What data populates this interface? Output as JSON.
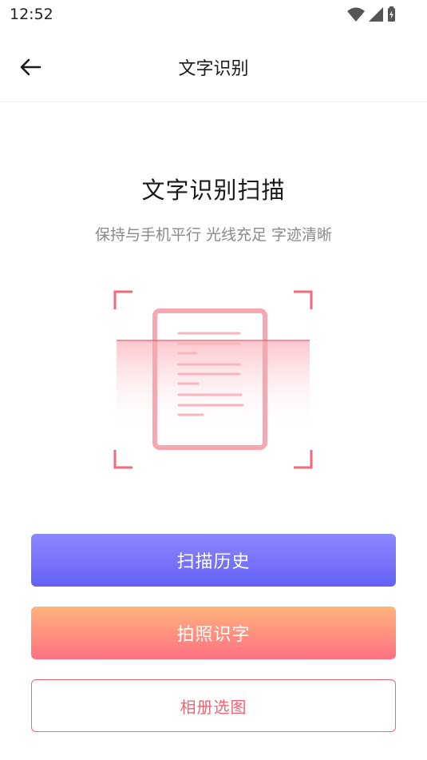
{
  "status_bar": {
    "time": "12:52",
    "icons": [
      "wifi-icon",
      "signal-icon",
      "battery-charging-icon"
    ]
  },
  "header": {
    "back_icon": "arrow-left-icon",
    "title": "文字识别"
  },
  "main": {
    "heading": "文字识别扫描",
    "subheading": "保持与手机平行 光线充足 字迹清晰",
    "illustration_icon": "document-scan-icon"
  },
  "actions": {
    "history_label": "扫描历史",
    "photo_label": "拍照识字",
    "album_label": "相册选图"
  },
  "colors": {
    "accent_purple": "#6561f6",
    "accent_orange": "#ffb37c",
    "accent_pink": "#ef6576"
  }
}
